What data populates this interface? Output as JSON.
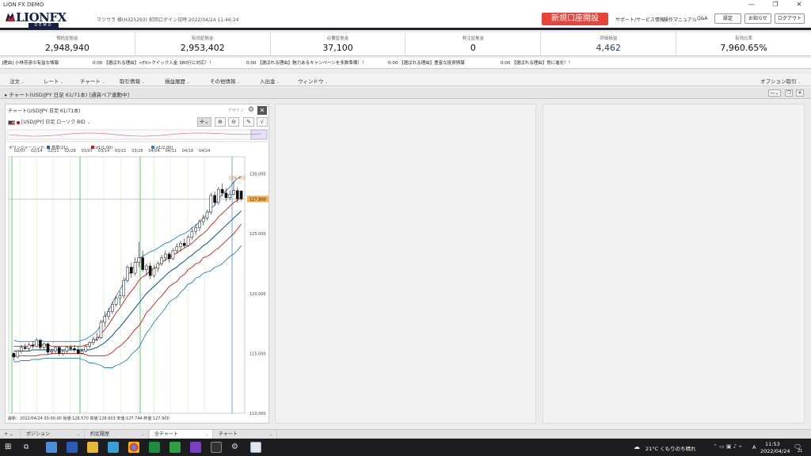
{
  "window": {
    "title": "LION FX DEMO",
    "minimize": "—",
    "maximize": "❐",
    "close": "✕"
  },
  "header": {
    "logo_text": "LIONFX",
    "logo_sub": "DEMO",
    "user": "マツウラ 様(H325293)",
    "last_login": "前回ログイン日時:2022/04/24 11:46:24",
    "new_account": "新規口座開設",
    "support_link": "サポート/サービス情報",
    "manual_link": "操作マニュアル",
    "qa_link": "Q&A",
    "settings": "設定",
    "notice": "お知らせ",
    "logout": "ログアウト"
  },
  "summary": [
    {
      "label": "預託証拠金",
      "value": "2,948,940"
    },
    {
      "label": "有効証拠金",
      "value": "2,953,402"
    },
    {
      "label": "必要証拠金",
      "value": "37,100"
    },
    {
      "label": "発注証拠金",
      "value": "0"
    },
    {
      "label": "評価損益",
      "value": "4,462"
    },
    {
      "label": "有効比率",
      "value": "7,960.65%"
    }
  ],
  "ticker": [
    "]理由] 小林芳彦の有益な情報",
    "0:00 【選ばれる理由】<FX>クイック入金 380行に対応！！",
    "0:00 【選ばれる理由】魅力あるキャンペーンを多数準備！！",
    "0:00 【選ばれる理由】豊富な投資情報",
    "0:00 【選ばれる理由】常に進化！！"
  ],
  "menu": [
    "注文",
    "レート",
    "チャート",
    "取引情報",
    "損益履歴",
    "その他情報",
    "入出金",
    "ウィンドウ"
  ],
  "menu_right": "オプション取引",
  "chart_window_title": "チャート(USD/JPY 日足 61/71本) [通貨ペア連動中]",
  "chart_panel": {
    "title": "チャート(USD/JPY 日足 61/71本)",
    "design": "デザイン",
    "pair_select": "[USD/JPY] 日足 ローソク BID",
    "legend_title": "ボリンジャーバンド:",
    "legend": [
      {
        "name": "基準(21)",
        "color": "#1f5fa0"
      },
      {
        "name": "σ1(1.00)",
        "color": "#d81818"
      },
      {
        "name": "σ1(2.00)",
        "color": "#2a7fd0"
      }
    ],
    "footer": "最新：2022/04/24 00:00:00  始値:128.570  高値:128.603  安値:127.744  終値:127.900"
  },
  "chart_data": {
    "type": "candlestick",
    "xlabels": [
      "02/07",
      "02/14",
      "02/21",
      "02/28",
      "03/07",
      "03/14",
      "03/21",
      "03/28",
      "04/04",
      "04/11",
      "04/18",
      "04/24"
    ],
    "yticks": [
      "130.000",
      "125.000",
      "120.000",
      "115.000",
      "110.000"
    ],
    "ylim": [
      110,
      130.5
    ],
    "last_price": "127.900",
    "high_label": "129.403",
    "candles": [
      [
        115.0,
        115.1,
        114.4,
        114.7
      ],
      [
        114.7,
        115.3,
        114.6,
        115.2
      ],
      [
        115.2,
        115.7,
        115.0,
        115.5
      ],
      [
        115.5,
        115.8,
        115.3,
        115.4
      ],
      [
        115.4,
        115.9,
        115.2,
        115.7
      ],
      [
        115.7,
        116.0,
        115.4,
        115.6
      ],
      [
        115.6,
        116.3,
        115.5,
        116.1
      ],
      [
        116.1,
        116.2,
        115.3,
        115.5
      ],
      [
        115.5,
        115.9,
        115.3,
        115.8
      ],
      [
        115.8,
        115.9,
        114.9,
        115.1
      ],
      [
        115.1,
        115.4,
        114.9,
        115.2
      ],
      [
        115.2,
        115.6,
        115.0,
        115.5
      ],
      [
        115.5,
        115.6,
        114.8,
        115.0
      ],
      [
        115.0,
        115.3,
        114.8,
        115.2
      ],
      [
        115.2,
        115.6,
        115.0,
        115.5
      ],
      [
        115.5,
        115.7,
        115.2,
        115.4
      ],
      [
        115.4,
        115.7,
        115.1,
        115.3
      ],
      [
        115.3,
        115.6,
        114.9,
        115.0
      ],
      [
        115.0,
        115.4,
        114.9,
        115.2
      ],
      [
        115.2,
        115.7,
        115.1,
        115.6
      ],
      [
        115.6,
        116.0,
        115.4,
        115.9
      ],
      [
        115.9,
        116.4,
        115.7,
        116.2
      ],
      [
        116.2,
        116.7,
        116.0,
        116.3
      ],
      [
        116.3,
        117.8,
        116.2,
        117.6
      ],
      [
        117.6,
        118.5,
        117.2,
        118.1
      ],
      [
        118.1,
        118.8,
        117.8,
        118.5
      ],
      [
        118.5,
        119.3,
        118.3,
        119.1
      ],
      [
        119.1,
        119.8,
        118.9,
        119.6
      ],
      [
        119.6,
        120.2,
        119.0,
        119.8
      ],
      [
        119.8,
        121.4,
        119.6,
        121.1
      ],
      [
        121.1,
        122.4,
        120.9,
        122.2
      ],
      [
        122.2,
        122.6,
        121.3,
        121.7
      ],
      [
        121.7,
        123.0,
        121.5,
        122.6
      ],
      [
        122.6,
        124.3,
        122.2,
        123.0
      ],
      [
        123.0,
        123.6,
        121.8,
        122.0
      ],
      [
        122.0,
        122.5,
        121.5,
        122.3
      ],
      [
        122.3,
        122.6,
        121.2,
        121.5
      ],
      [
        121.5,
        122.4,
        121.3,
        122.1
      ],
      [
        122.1,
        122.7,
        121.8,
        122.5
      ],
      [
        122.5,
        123.2,
        122.3,
        123.0
      ],
      [
        123.0,
        123.6,
        122.7,
        123.3
      ],
      [
        123.3,
        123.5,
        122.6,
        122.9
      ],
      [
        122.9,
        123.8,
        122.8,
        123.6
      ],
      [
        123.6,
        124.2,
        123.3,
        123.9
      ],
      [
        123.9,
        124.4,
        123.5,
        124.2
      ],
      [
        124.2,
        124.6,
        123.8,
        124.0
      ],
      [
        124.0,
        124.9,
        123.9,
        124.7
      ],
      [
        124.7,
        125.5,
        124.5,
        125.2
      ],
      [
        125.2,
        125.8,
        124.9,
        125.5
      ],
      [
        125.5,
        126.2,
        125.2,
        126.0
      ],
      [
        126.0,
        126.6,
        125.7,
        126.3
      ],
      [
        126.3,
        127.0,
        126.1,
        126.8
      ],
      [
        126.8,
        128.4,
        126.6,
        128.2
      ],
      [
        128.2,
        128.5,
        127.3,
        127.6
      ],
      [
        127.6,
        128.9,
        127.4,
        128.7
      ],
      [
        128.7,
        129.2,
        128.1,
        128.4
      ],
      [
        128.4,
        128.8,
        127.7,
        128.0
      ],
      [
        128.0,
        128.6,
        127.8,
        128.3
      ],
      [
        128.3,
        129.4,
        128.2,
        128.6
      ],
      [
        128.6,
        128.9,
        127.6,
        127.9
      ],
      [
        128.57,
        128.603,
        127.744,
        127.9
      ]
    ],
    "bands": {
      "upper2": [
        116.1,
        116.0,
        116.0,
        116.0,
        116.0,
        116.0,
        116.0,
        116.1,
        116.0,
        116.0,
        116.0,
        116.0,
        116.0,
        116.0,
        116.0,
        116.0,
        116.0,
        116.0,
        116.1,
        116.2,
        116.4,
        116.6,
        116.9,
        117.4,
        118.0,
        118.6,
        119.2,
        119.8,
        120.3,
        120.9,
        121.5,
        121.9,
        122.4,
        122.9,
        123.1,
        123.3,
        123.5,
        123.6,
        123.8,
        124.0,
        124.2,
        124.3,
        124.5,
        124.7,
        124.9,
        125.0,
        125.2,
        125.5,
        125.7,
        126.0,
        126.3,
        126.6,
        127.1,
        127.4,
        127.9,
        128.3,
        128.6,
        128.9,
        129.3,
        129.6,
        129.8
      ],
      "upper1": [
        115.6,
        115.6,
        115.6,
        115.6,
        115.6,
        115.7,
        115.7,
        115.7,
        115.7,
        115.7,
        115.6,
        115.6,
        115.6,
        115.6,
        115.6,
        115.6,
        115.6,
        115.6,
        115.6,
        115.7,
        115.8,
        116.0,
        116.2,
        116.6,
        117.0,
        117.4,
        117.9,
        118.4,
        118.8,
        119.3,
        119.8,
        120.2,
        120.6,
        121.1,
        121.4,
        121.6,
        121.9,
        122.1,
        122.3,
        122.6,
        122.8,
        123.0,
        123.2,
        123.4,
        123.6,
        123.8,
        124.0,
        124.2,
        124.5,
        124.8,
        125.0,
        125.3,
        125.7,
        126.0,
        126.4,
        126.7,
        127.0,
        127.3,
        127.6,
        127.8,
        128.0
      ],
      "middle": [
        115.2,
        115.2,
        115.2,
        115.2,
        115.2,
        115.3,
        115.3,
        115.3,
        115.3,
        115.3,
        115.3,
        115.3,
        115.3,
        115.3,
        115.3,
        115.3,
        115.3,
        115.3,
        115.3,
        115.3,
        115.3,
        115.4,
        115.5,
        115.7,
        115.9,
        116.2,
        116.5,
        116.9,
        117.2,
        117.6,
        118.0,
        118.4,
        118.8,
        119.2,
        119.6,
        120.0,
        120.3,
        120.6,
        120.9,
        121.2,
        121.5,
        121.8,
        122.0,
        122.2,
        122.5,
        122.7,
        123.0,
        123.2,
        123.5,
        123.7,
        124.0,
        124.2,
        124.5,
        124.8,
        125.1,
        125.4,
        125.7,
        126.0,
        126.3,
        126.6,
        126.9
      ],
      "lower1": [
        114.8,
        114.8,
        114.8,
        114.8,
        114.8,
        114.8,
        114.8,
        114.9,
        114.9,
        114.9,
        115.0,
        115.0,
        115.0,
        115.0,
        115.0,
        115.0,
        115.0,
        115.0,
        115.0,
        114.9,
        114.8,
        114.8,
        114.8,
        114.8,
        114.8,
        114.9,
        115.1,
        115.4,
        115.6,
        115.9,
        116.2,
        116.6,
        117.0,
        117.3,
        117.8,
        118.4,
        118.7,
        119.1,
        119.5,
        119.8,
        120.2,
        120.6,
        120.8,
        121.0,
        121.4,
        121.6,
        122.0,
        122.2,
        122.5,
        122.6,
        123.0,
        123.1,
        123.3,
        123.6,
        123.8,
        124.1,
        124.4,
        124.7,
        125.0,
        125.4,
        125.8
      ],
      "lower2": [
        114.3,
        114.3,
        114.4,
        114.4,
        114.4,
        114.5,
        114.5,
        114.5,
        114.6,
        114.6,
        114.6,
        114.6,
        114.6,
        114.6,
        114.6,
        114.6,
        114.6,
        114.6,
        114.5,
        114.4,
        114.2,
        114.2,
        114.1,
        114.0,
        113.8,
        113.8,
        113.8,
        114.0,
        114.1,
        114.3,
        114.5,
        114.9,
        115.2,
        115.5,
        116.1,
        116.7,
        117.1,
        117.6,
        118.0,
        118.4,
        118.8,
        119.3,
        119.5,
        119.7,
        120.1,
        120.4,
        120.8,
        120.9,
        121.3,
        121.4,
        121.7,
        121.8,
        121.9,
        122.2,
        122.3,
        122.5,
        122.8,
        123.1,
        123.3,
        123.6,
        124.0
      ]
    }
  },
  "bottom_tabs": [
    "ポジション",
    "約定履歴",
    "全チャート",
    "チャート"
  ],
  "taskbar": {
    "weather": "21°C くもりのち晴れ",
    "time": "11:53",
    "date": "2022/04/24",
    "lang": "A",
    "notif": "21"
  }
}
